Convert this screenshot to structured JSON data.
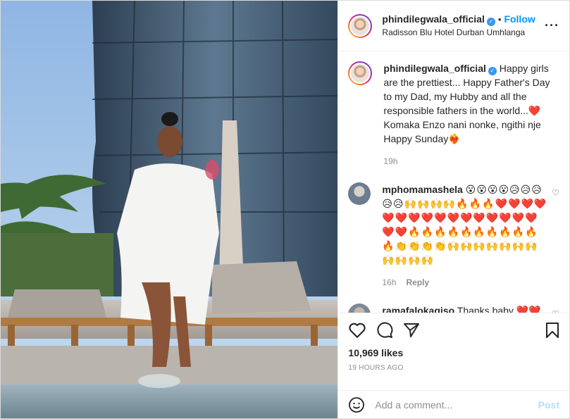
{
  "header": {
    "username": "phindilegwala_official",
    "verified": true,
    "separator": "•",
    "follow_label": "Follow",
    "location": "Radisson Blu Hotel Durban Umhlanga",
    "more_label": "···"
  },
  "caption": {
    "username": "phindilegwala_official",
    "text": "Happy girls are the prettiest... Happy Father's Day to my Dad, my Hubby and all the responsible fathers in the world...❤️ Komaka Enzo nani nonke, ngithi nje Happy Sunday❤️‍🔥",
    "time": "19h"
  },
  "comments": [
    {
      "username": "mphomamashela",
      "text": "😮😮😮😮😥😥😥😥😥🙌🙌🙌🙌🔥🔥🔥❤️❤️❤️❤️❤️❤️❤️❤️❤️❤️❤️❤️❤️❤️❤️❤️❤️❤️🔥🔥🔥🔥🔥🔥🔥🔥🔥🔥🔥👏👏👏👏🙌🙌🙌🙌🙌🙌🙌🙌🙌🙌🙌",
      "time": "16h",
      "reply_label": "Reply"
    },
    {
      "username": "ramafalokagiso",
      "text": "Thanks baby ❤️❤️"
    }
  ],
  "actions": {
    "likes": "10,969 likes",
    "timestamp": "19 HOURS AGO"
  },
  "add_comment": {
    "placeholder": "Add a comment...",
    "post_label": "Post"
  },
  "colors": {
    "link_blue": "#0095f6",
    "post_disabled": "#b2dffc",
    "muted": "#8e8e8e"
  }
}
